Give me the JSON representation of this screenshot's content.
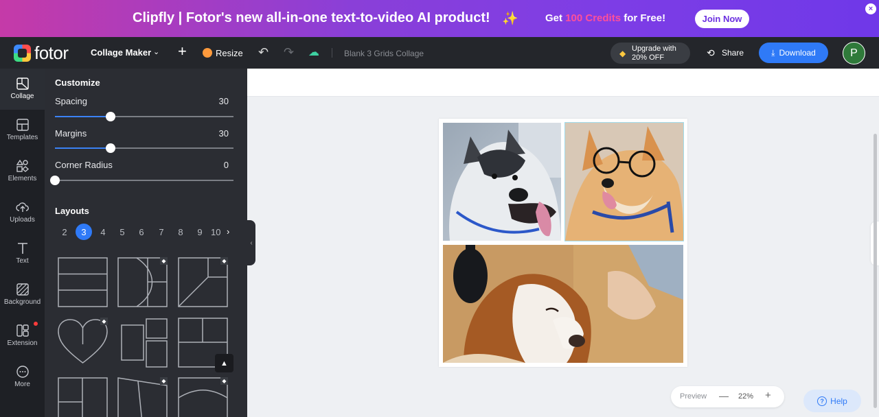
{
  "banner": {
    "title": "Clipfly | Fotor's new all-in-one text-to-video AI product!",
    "offer_prefix": "Get ",
    "offer_highlight": "100 Credits",
    "offer_suffix": " for Free!",
    "join_label": "Join Now",
    "close_label": "×"
  },
  "topbar": {
    "logo_text": "fotor",
    "tool_name": "Collage Maker",
    "resize_label": "Resize",
    "document_title": "Blank 3 Grids Collage",
    "upgrade_line1": "Upgrade with",
    "upgrade_line2": "20% OFF",
    "share_label": "Share",
    "download_label": "Download",
    "avatar_initial": "P"
  },
  "rail": {
    "items": [
      {
        "label": "Collage",
        "icon": "collage-icon"
      },
      {
        "label": "Templates",
        "icon": "templates-icon"
      },
      {
        "label": "Elements",
        "icon": "elements-icon"
      },
      {
        "label": "Uploads",
        "icon": "uploads-icon"
      },
      {
        "label": "Text",
        "icon": "text-icon"
      },
      {
        "label": "Background",
        "icon": "background-icon"
      },
      {
        "label": "Extension",
        "icon": "extension-icon"
      },
      {
        "label": "More",
        "icon": "more-icon"
      }
    ]
  },
  "customize": {
    "heading": "Customize",
    "spacing_label": "Spacing",
    "spacing_value": "30",
    "spacing_level": 0.31,
    "margins_label": "Margins",
    "margins_value": "30",
    "margins_level": 0.31,
    "radius_label": "Corner Radius",
    "radius_value": "0",
    "radius_level": 0
  },
  "layouts": {
    "heading": "Layouts",
    "counts": [
      "2",
      "3",
      "4",
      "5",
      "6",
      "7",
      "8",
      "9",
      "10"
    ],
    "selected": "3"
  },
  "zoom": {
    "preview_label": "Preview",
    "percent": "22%"
  },
  "help": {
    "label": "Help"
  },
  "colors": {
    "accent": "#2f7af7",
    "banner_start": "#c53aa8",
    "banner_end": "#6f38e8",
    "panel_bg": "#2b2d33"
  }
}
